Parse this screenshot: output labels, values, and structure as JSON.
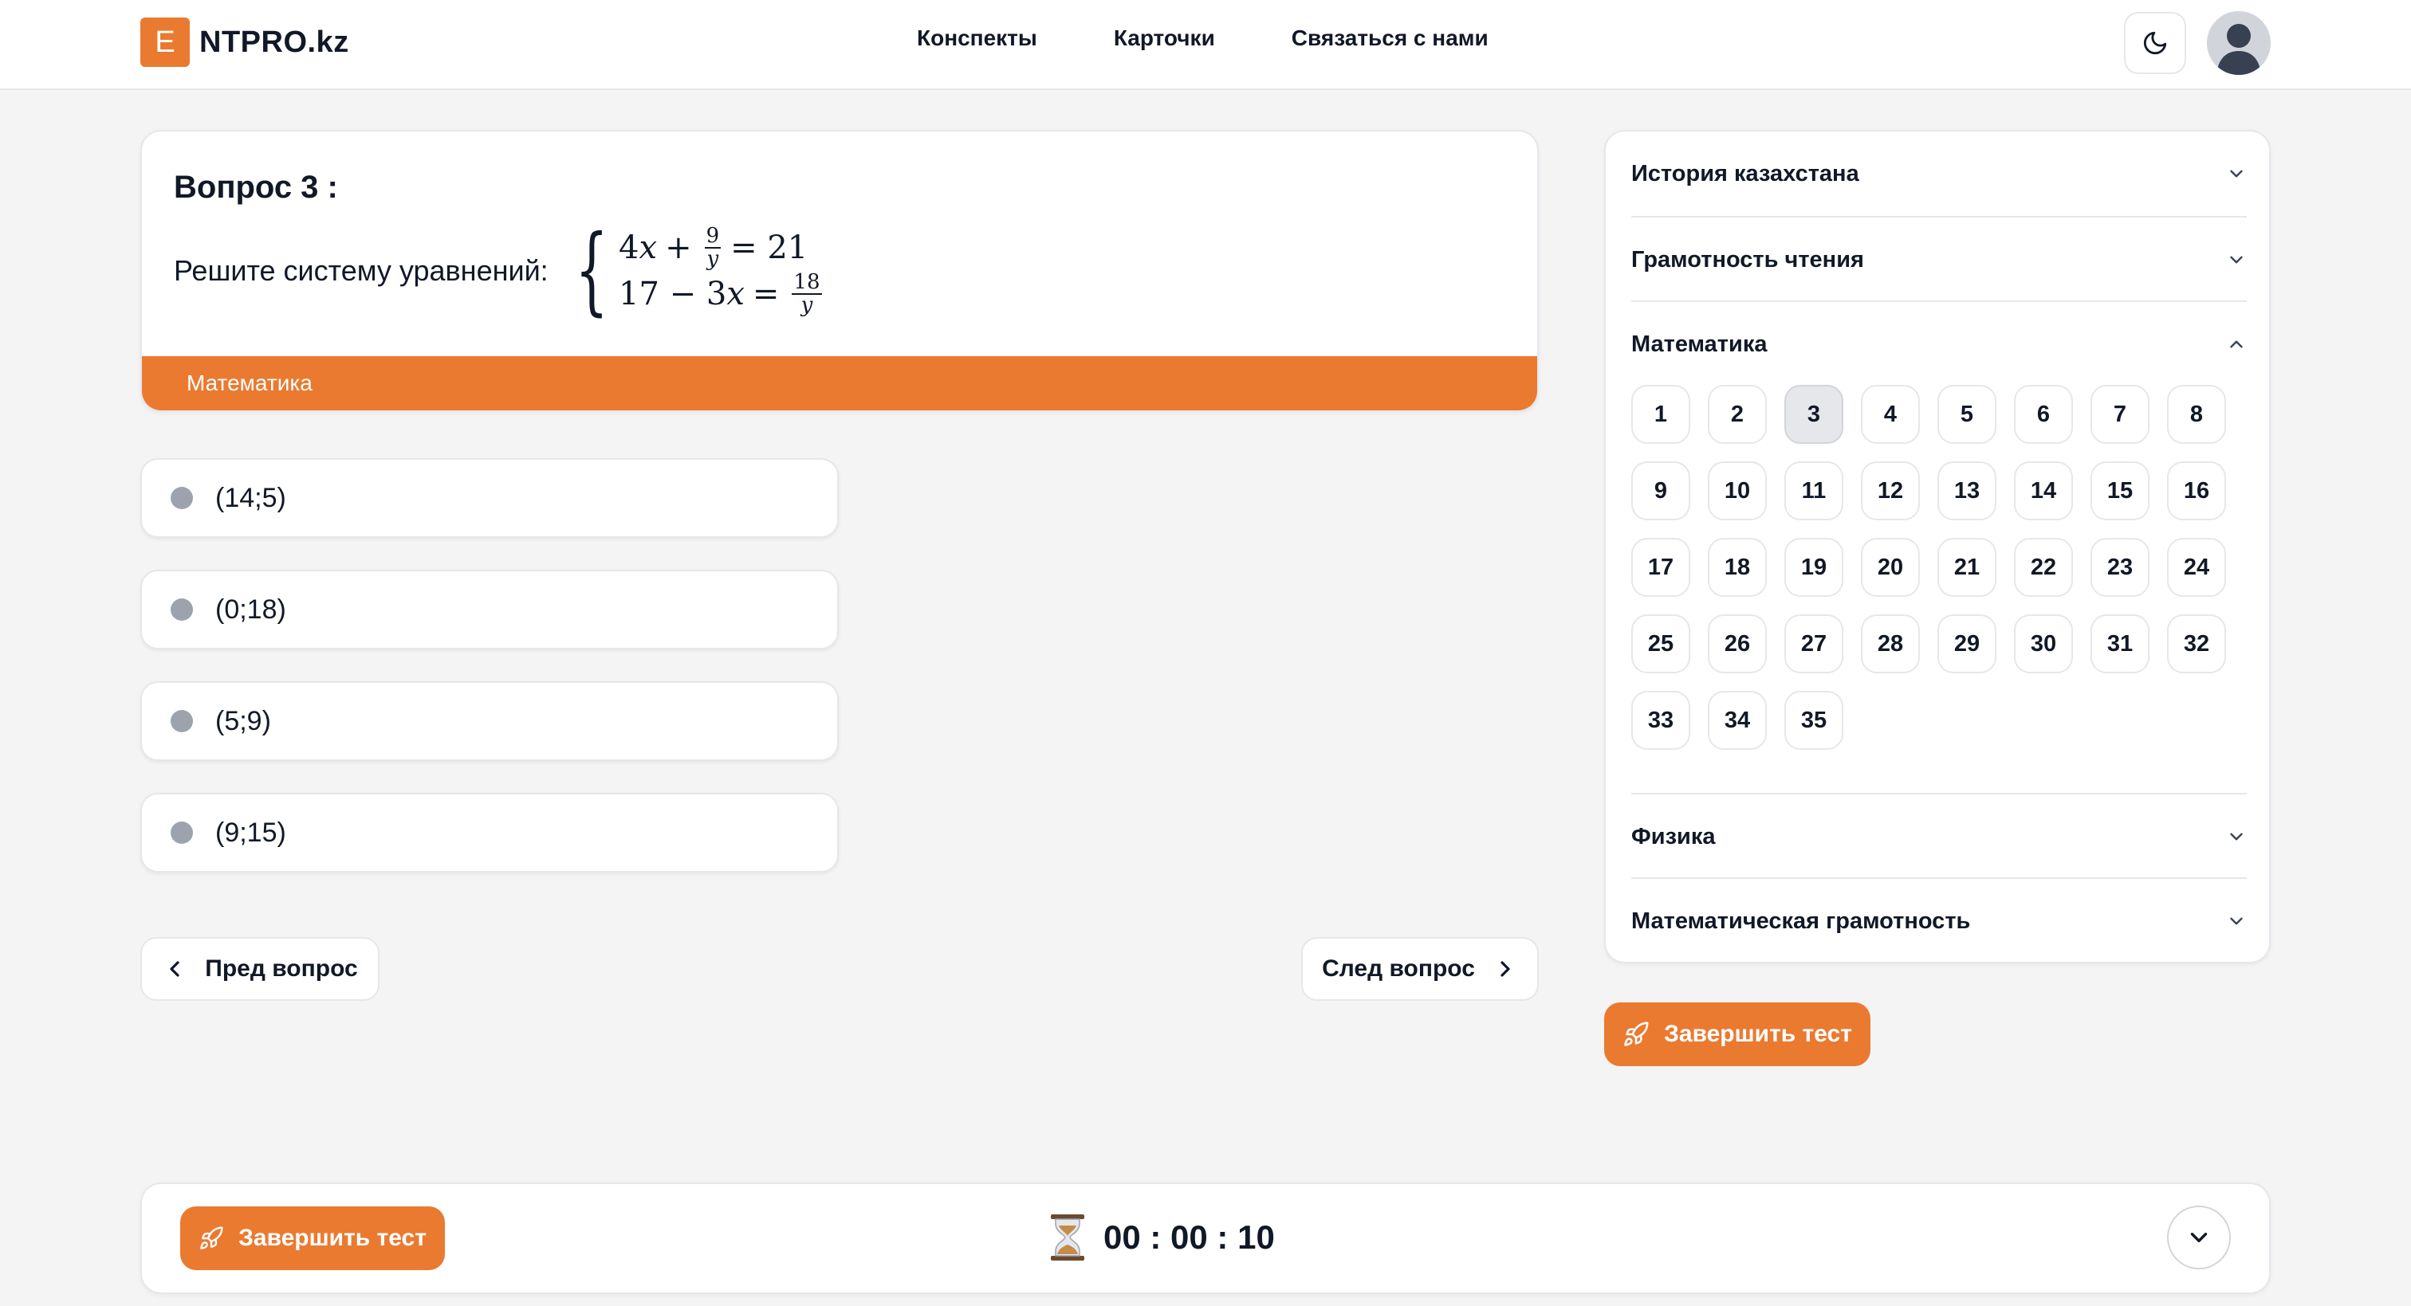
{
  "header": {
    "logo_letter": "E",
    "logo_text": "NTPRO.kz",
    "nav": [
      "Конспекты",
      "Карточки",
      "Связаться с нами"
    ]
  },
  "question": {
    "title": "Вопрос 3 :",
    "prompt": "Решите систему уравнений:",
    "equation_1": {
      "lhs_a": "4",
      "lhs_var": "x",
      "op": "+",
      "frac_num": "9",
      "frac_den": "y",
      "rhs": "= 21"
    },
    "equation_2": {
      "lhs": "17 − 3",
      "lhs_var": "x",
      "eq": "=",
      "frac_num": "18",
      "frac_den": "y"
    },
    "subject": "Математика"
  },
  "options": [
    "(14;5)",
    "(0;18)",
    "(5;9)",
    "(9;15)"
  ],
  "navigation": {
    "prev": "Пред вопрос",
    "next": "След вопрос"
  },
  "sidebar": {
    "sections": [
      "История казахстана",
      "Грамотность чтения",
      "Математика",
      "Физика",
      "Математическая грамотность"
    ],
    "expanded": "Математика",
    "question_numbers": [
      "1",
      "2",
      "3",
      "4",
      "5",
      "6",
      "7",
      "8",
      "9",
      "10",
      "11",
      "12",
      "13",
      "14",
      "15",
      "16",
      "17",
      "18",
      "19",
      "20",
      "21",
      "22",
      "23",
      "24",
      "25",
      "26",
      "27",
      "28",
      "29",
      "30",
      "31",
      "32",
      "33",
      "34",
      "35"
    ],
    "active_question": "3"
  },
  "finish_label": "Завершить тест",
  "timer": "00 : 00 : 10",
  "colors": {
    "accent": "#ea7a30"
  }
}
